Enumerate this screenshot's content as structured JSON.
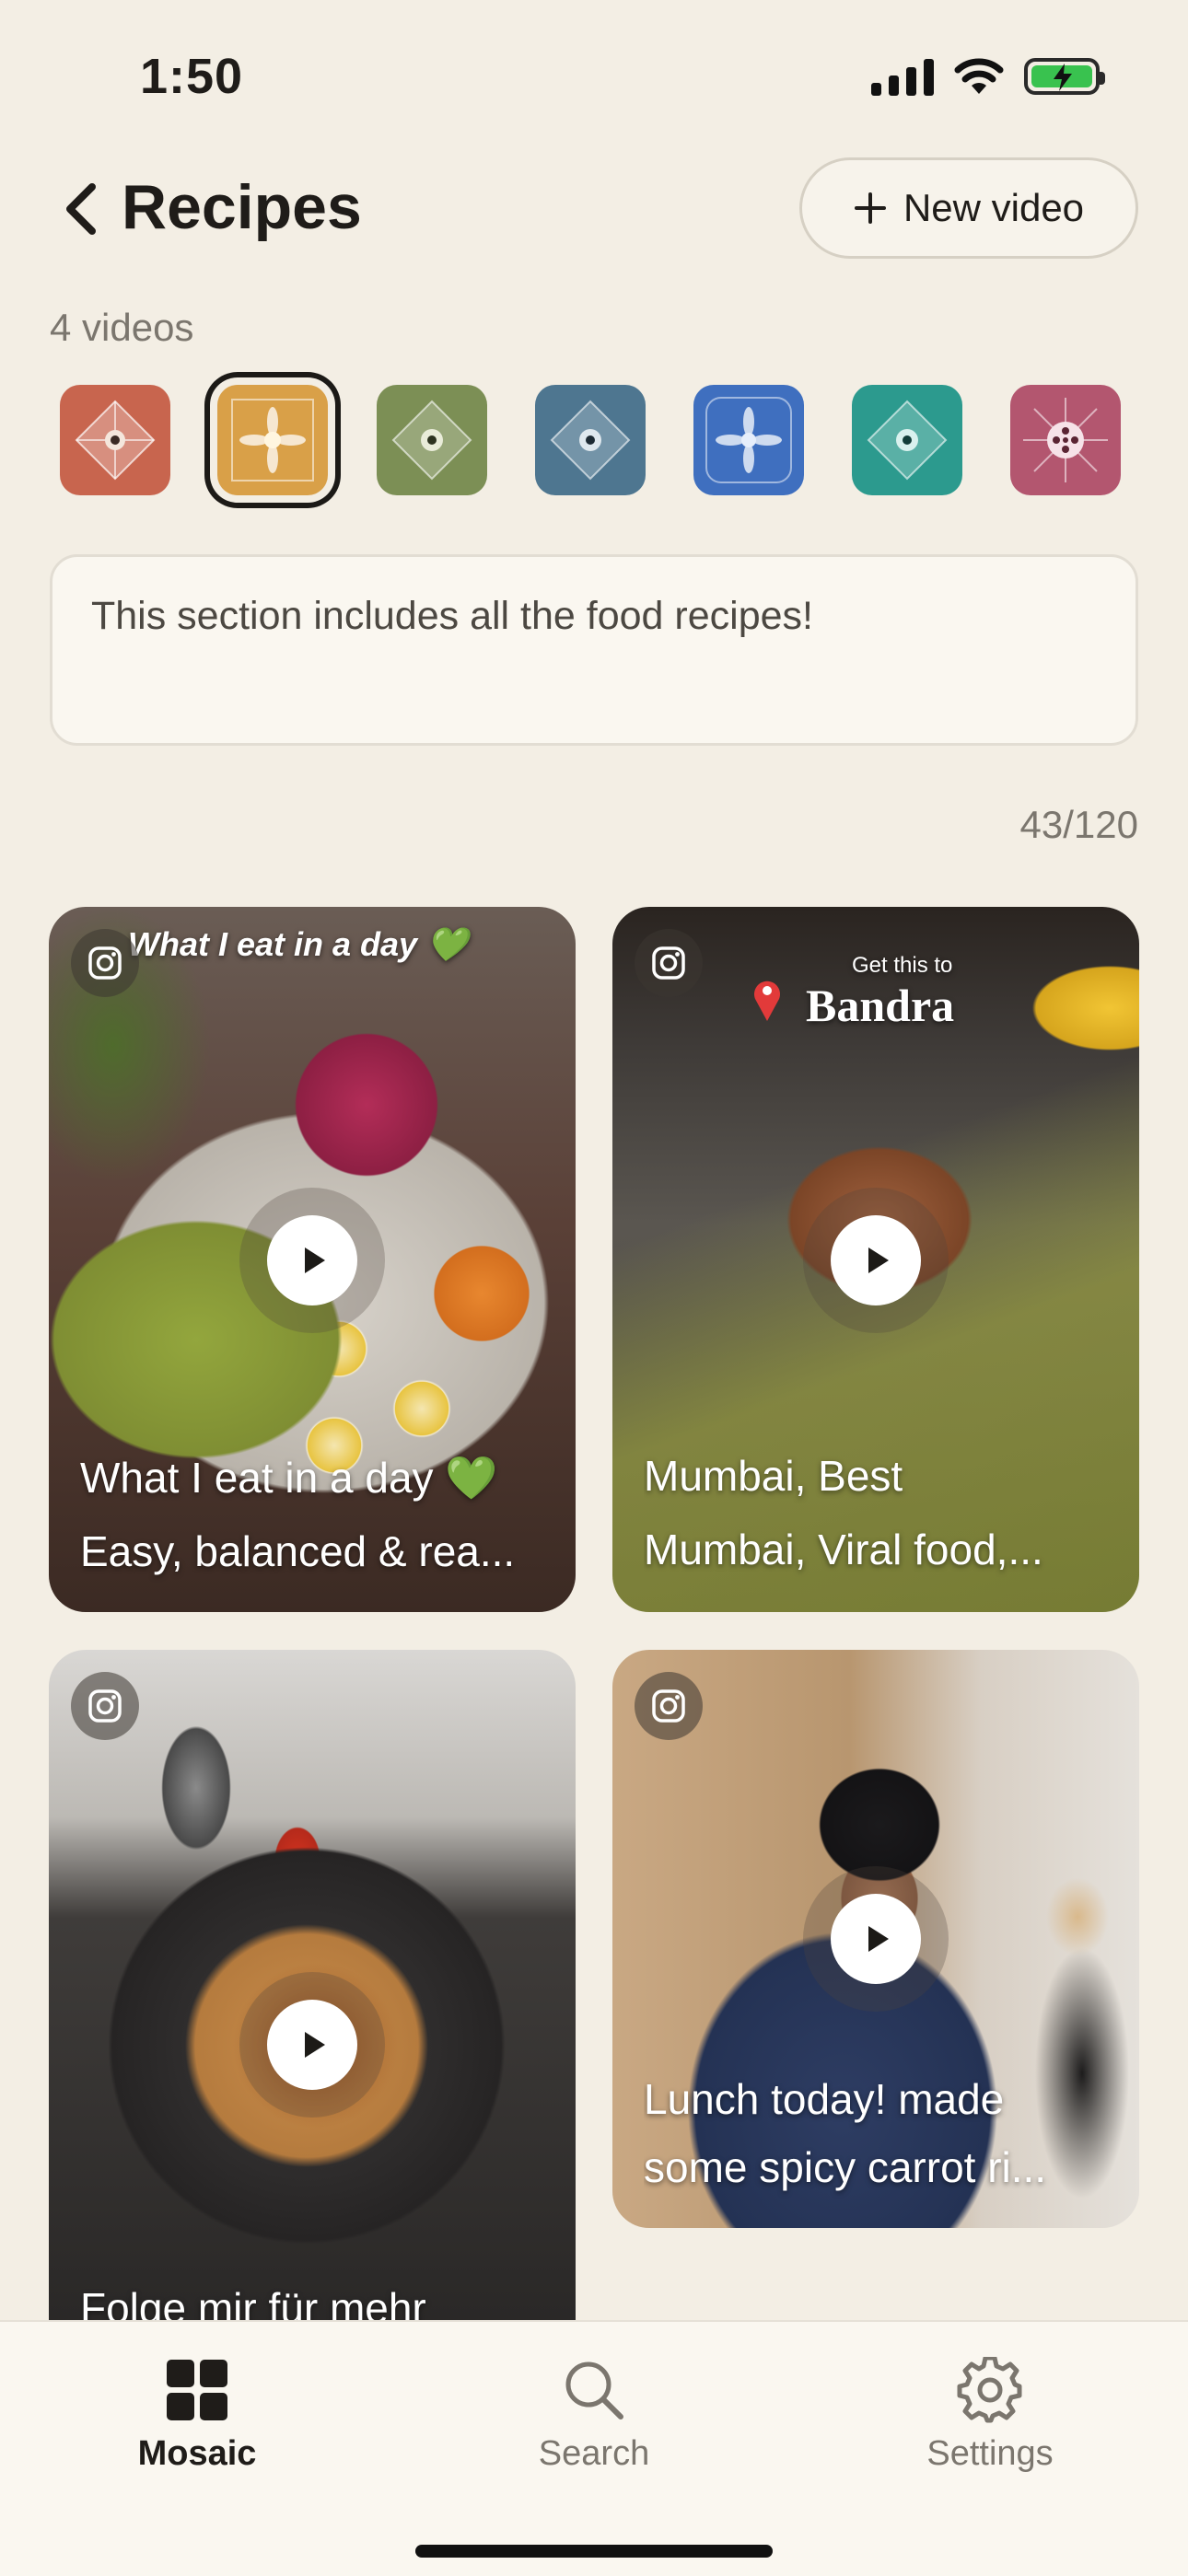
{
  "status_bar": {
    "time": "1:50"
  },
  "header": {
    "title": "Recipes",
    "new_video_label": "New video",
    "video_count": "4 videos"
  },
  "theme_icons": [
    {
      "name": "terracotta",
      "color": "#c8654e"
    },
    {
      "name": "mustard",
      "color": "#d9a048",
      "selected": true
    },
    {
      "name": "olive",
      "color": "#7c8f55"
    },
    {
      "name": "slate-blue",
      "color": "#4e7690"
    },
    {
      "name": "royal-blue",
      "color": "#3f6fbf"
    },
    {
      "name": "teal",
      "color": "#2c9a8e"
    },
    {
      "name": "rose",
      "color": "#b3566f"
    }
  ],
  "description": {
    "text": "This section includes all the food recipes!",
    "char_count": "43/120"
  },
  "videos": [
    {
      "overlay": "What I eat in a day 💚",
      "caption_line1": "What I eat in a day 💚",
      "caption_line2": "Easy, balanced & rea..."
    },
    {
      "overlay_small": "Get this to",
      "overlay": "Bandra",
      "caption_line1": "Mumbai, Best",
      "caption_line2": "Mumbai, Viral food,..."
    },
    {
      "caption_line1": "Folge mir für mehr"
    },
    {
      "caption_line1": "Lunch today! made",
      "caption_line2": "some spicy carrot ri..."
    }
  ],
  "tabs": {
    "mosaic": "Mosaic",
    "search": "Search",
    "settings": "Settings"
  },
  "colors": {
    "background": "#f3eee4",
    "text": "#1f1c19",
    "muted": "#7b766e"
  }
}
